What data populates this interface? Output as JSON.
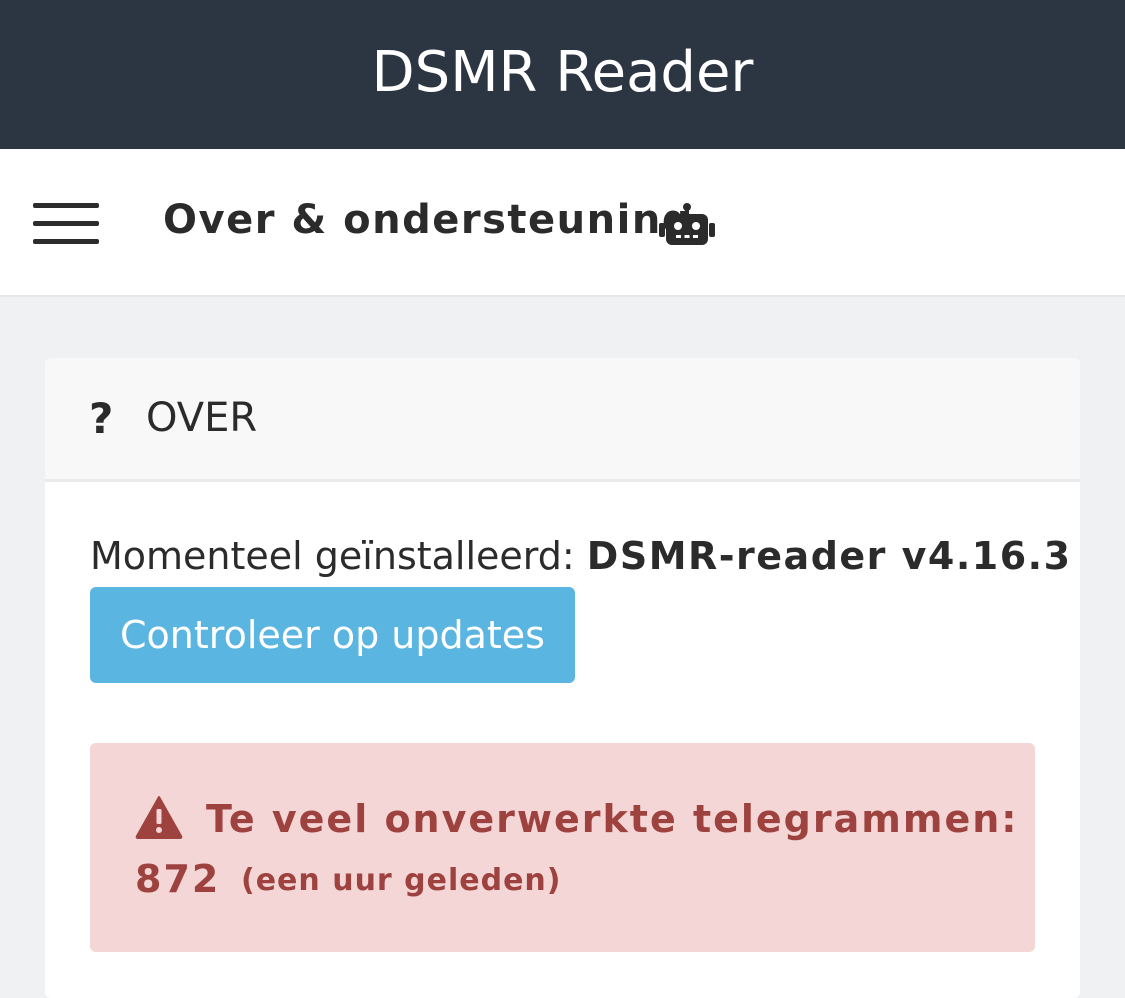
{
  "header": {
    "app_title": "DSMR Reader"
  },
  "subheader": {
    "menu_icon": "hamburger-menu-icon",
    "page_title": "Over & ondersteuning",
    "title_icon": "robot-icon"
  },
  "panel": {
    "icon": "question-icon",
    "title": "OVER",
    "installed_label": "Momenteel geïnstalleerd:",
    "installed_version": "DSMR-reader v4.16.3",
    "update_button_label": "Controleer op updates"
  },
  "alert": {
    "icon": "warning-icon",
    "message": "Te veel onverwerkte telegrammen:",
    "count": "872",
    "time": "(een uur geleden)"
  },
  "colors": {
    "topbar": "#2c3643",
    "button": "#5bb5e1",
    "alert_bg": "#f3d6d5",
    "alert_text": "#9e4240"
  }
}
